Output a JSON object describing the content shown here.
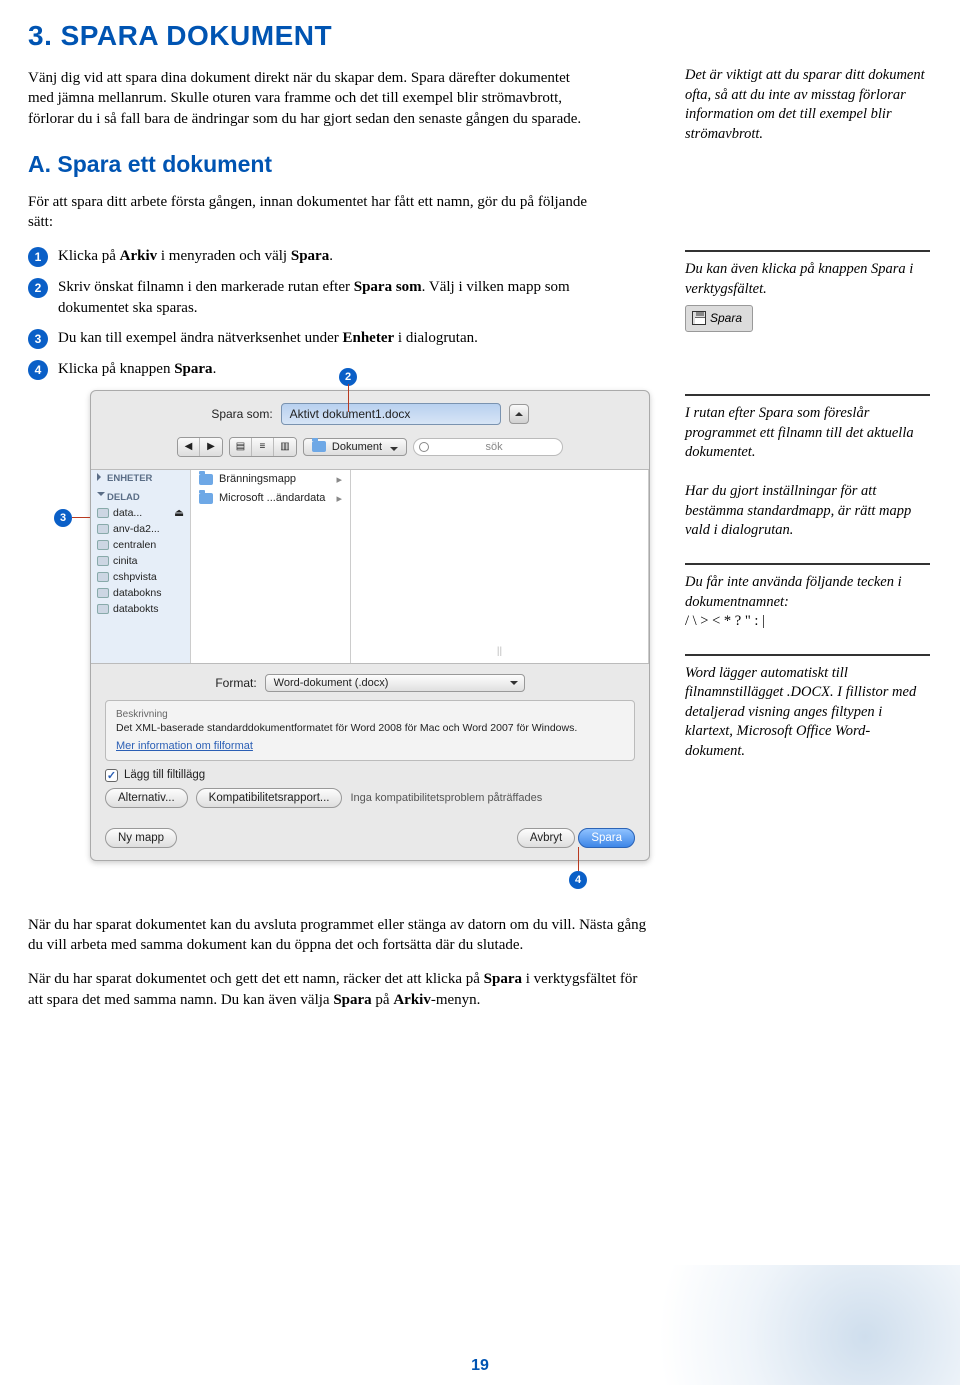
{
  "heading": "3. SPARA DOKUMENT",
  "intro": "Vänj dig vid att spara dina dokument direkt när du skapar dem. Spara därefter dokumentet med jämna mellanrum. Skulle oturen vara framme och det till exempel blir strömavbrott, förlorar du i så fall bara de ändringar som du har gjort sedan den senaste gången du sparade.",
  "subheading": "A. Spara ett dokument",
  "lead": "För att spara ditt arbete första gången, innan dokumentet har fått ett namn, gör du på följande sätt:",
  "steps": {
    "s1a": "Klicka på ",
    "s1b": "Arkiv",
    "s1c": " i menyraden och välj ",
    "s1d": "Spara",
    "s1e": ".",
    "s2a": "Skriv önskat filnamn i den markerade rutan efter ",
    "s2b": "Spara som",
    "s2c": ". Välj i vilken mapp som dokumentet ska sparas.",
    "s3a": "Du kan till exempel ändra nätverksenhet under ",
    "s3b": "Enheter",
    "s3c": " i dialogrutan.",
    "s4a": "Klicka på knappen ",
    "s4b": "Spara",
    "s4c": "."
  },
  "side": {
    "n1": "Det är viktigt att du sparar ditt dokument ofta, så att du inte av misstag förlorar information om det till exempel blir ström­avbrott.",
    "n2": "Du kan även klicka på knappen Spara i verktygsfältet.",
    "spara": "Spara",
    "n3": "I rutan efter Spara som föreslår programmet ett filnamn till det aktuella dokumentet.",
    "n3b": "Har du gjort inställningar för att bestämma standardmapp, är rätt mapp vald i dialogrutan.",
    "n4a": "Du får inte använda följande tecken i dokumentnamnet:",
    "n4b": "/ \\ > < * ? \" : |",
    "n5": "Word lägger automatiskt till filnamnstillägget .DOCX. I fillistor med detaljerad visning anges filtypen i klartext, Microsoft Office Word-dokument."
  },
  "dialog": {
    "saveas_lbl": "Spara som:",
    "saveas_val": "Aktivt dokument1.docx",
    "path": "Dokument",
    "search_ph": "sök",
    "side_hdr1": "ENHETER",
    "side_hdr2": "DELAD",
    "shared": [
      "data...",
      "anv-da2...",
      "centralen",
      "cinita",
      "cshpvista",
      "databokns",
      "databokts"
    ],
    "eject": "⏏",
    "col1a": "Bränningsmapp",
    "col1b": "Microsoft ...ändardata",
    "format_lbl": "Format:",
    "format_val": "Word-dokument (.docx)",
    "desc_ttl": "Beskrivning",
    "desc_txt": "Det XML-baserade standarddokumentformatet för Word 2008 för Mac och Word 2007 för Windows.",
    "more": "Mer information om filformat",
    "addext": "Lägg till filtillägg",
    "alt": "Alternativ...",
    "compat": "Kompatibilitetsrapport...",
    "status": "Inga kompatibilitetsproblem påträffades",
    "newf": "Ny mapp",
    "cancel": "Avbryt",
    "save": "Spara"
  },
  "after1": "När du har sparat dokumentet kan du avsluta programmet eller stänga av datorn om du vill. Nästa gång du vill arbeta med samma dokument kan du öppna det och fortsätta där du slutade.",
  "after2a": "När du har sparat dokumentet och gett det ett namn, räcker det att klicka på ",
  "after2b": "Spara",
  "after2c": " i verktygsfältet för att spara det med samma namn. Du kan även välja ",
  "after2d": "Spara",
  "after2e": " på ",
  "after2f": "Arkiv",
  "after2g": "-menyn.",
  "pagenum": "19",
  "callouts": {
    "c2": "2",
    "c3": "3",
    "c4": "4"
  }
}
